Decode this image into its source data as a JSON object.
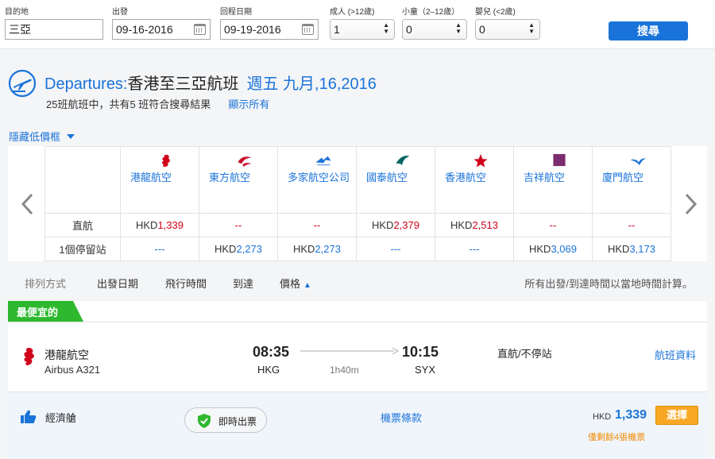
{
  "search": {
    "destination_label": "目的地",
    "destination_value": "三亞",
    "depart_label": "出發",
    "depart_value": "09-16-2016",
    "return_label": "回程日期",
    "return_value": "09-19-2016",
    "adults_label": "成人 (>12歲)",
    "adults_value": "1",
    "children_label": "小童（2–12歲）",
    "children_value": "0",
    "infants_label": "嬰兒 (<2歲)",
    "infants_value": "0",
    "search_button": "搜尋"
  },
  "heading": {
    "departures": "Departures:",
    "route": "香港至三亞航班",
    "date": "週五 九月,16,2016",
    "summary": "25班航班中，共有5 班符合搜尋結果",
    "show_all": "顯示所有",
    "hide_matrix": "隱藏低價框"
  },
  "matrix": {
    "row_labels": [
      "直航",
      "1個停留站"
    ],
    "currency": "HKD",
    "airlines": [
      {
        "name": "港龍航空",
        "direct": "1,339",
        "one_stop": "---",
        "logo_color": "#d0021b"
      },
      {
        "name": "東方航空",
        "direct": "--",
        "one_stop": "2,273",
        "logo_color": "#c8102e"
      },
      {
        "name": "多家航空公司",
        "direct": "--",
        "one_stop": "2,273",
        "logo_color": "#1a73d9"
      },
      {
        "name": "國泰航空",
        "direct": "2,379",
        "one_stop": "---",
        "logo_color": "#006564"
      },
      {
        "name": "香港航空",
        "direct": "2,513",
        "one_stop": "---",
        "logo_color": "#d0021b"
      },
      {
        "name": "吉祥航空",
        "direct": "--",
        "one_stop": "3,069",
        "logo_color": "#7b2d6e"
      },
      {
        "name": "廈門航空",
        "direct": "--",
        "one_stop": "3,173",
        "logo_color": "#1a73d9"
      }
    ]
  },
  "sort": {
    "label": "排列方式",
    "options": [
      "出發日期",
      "飛行時間",
      "到達",
      "價格"
    ],
    "note": "所有出發/到達時間以當地時間計算。"
  },
  "result": {
    "badge": "最便宜的",
    "airline": "港龍航空",
    "aircraft": "Airbus A321",
    "depart_time": "08:35",
    "arrive_time": "10:15",
    "depart_code": "HKG",
    "arrive_code": "SYX",
    "duration": "1h40m",
    "stops": "直航/不停站",
    "details_link": "航班資料",
    "cabin": "經濟艙",
    "instant_ticket": "即時出票",
    "fare_rules": "機票條款",
    "currency": "HKD",
    "price": "1,339",
    "select_button": "選擇",
    "seats_left": "僅剩餘4張機票"
  },
  "colors": {
    "accent": "#1a73d9",
    "badge_green": "#2eb82e",
    "select_orange": "#f9a825",
    "price_red": "#d0021b"
  }
}
